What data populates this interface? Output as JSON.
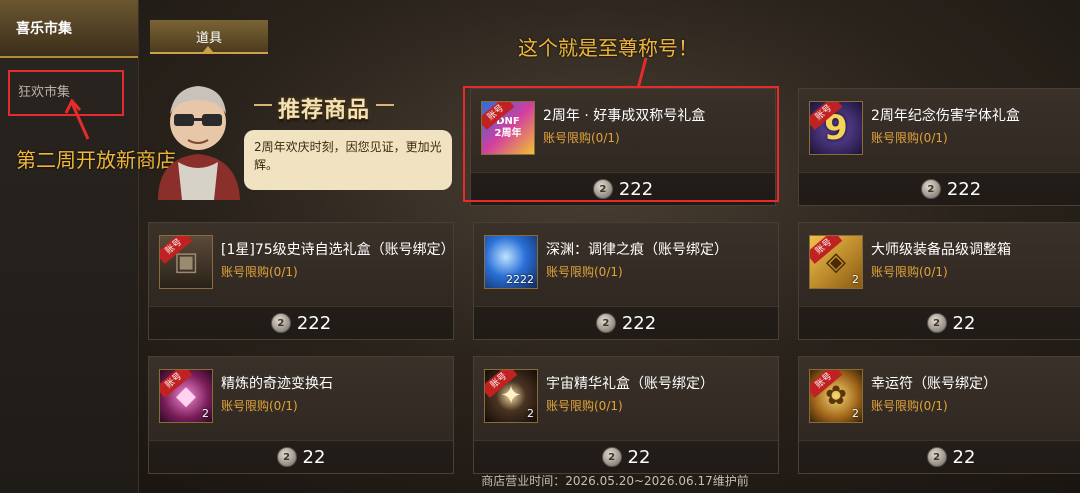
{
  "sidebar": {
    "market_tab": "喜乐市集",
    "sub_tab": "狂欢市集"
  },
  "tabs": {
    "items": "道具"
  },
  "annotations": {
    "left_note": "第二周开放新商店",
    "top_note": "这个就是至尊称号！"
  },
  "recommend": {
    "title": "推荐商品",
    "bubble": "2周年欢庆时刻，因您见证，更加光辉。"
  },
  "cards": [
    {
      "name": "2周年 · 好事成双称号礼盒",
      "limit": "账号限购(0/1)",
      "price": "222",
      "badge": "账号",
      "icon": "dnf-title-box-icon",
      "qty": ""
    },
    {
      "name": "2周年纪念伤害字体礼盒",
      "limit": "账号限购(0/1)",
      "price": "222",
      "badge": "账号",
      "icon": "number-nine-icon",
      "qty": ""
    },
    {
      "name": "[1星]75级史诗自选礼盒（账号绑定）",
      "limit": "账号限购(0/1)",
      "price": "222",
      "badge": "账号",
      "icon": "treasure-chest-icon",
      "qty": ""
    },
    {
      "name": "深渊：调律之痕（账号绑定）",
      "limit": "账号限购(0/1)",
      "price": "222",
      "badge": "",
      "icon": "blue-orb-icon",
      "qty": "2222"
    },
    {
      "name": "大师级装备品级调整箱",
      "limit": "账号限购(0/1)",
      "price": "22",
      "badge": "账号",
      "icon": "gold-cube-icon",
      "qty": "2"
    },
    {
      "name": "精炼的奇迹变换石",
      "limit": "账号限购(0/1)",
      "price": "22",
      "badge": "账号",
      "icon": "pink-crystal-icon",
      "qty": "2"
    },
    {
      "name": "宇宙精华礼盒（账号绑定）",
      "limit": "账号限购(0/1)",
      "price": "22",
      "badge": "账号",
      "icon": "dark-star-icon",
      "qty": "2"
    },
    {
      "name": "幸运符（账号绑定）",
      "limit": "账号限购(0/1)",
      "price": "22",
      "badge": "账号",
      "icon": "gold-charm-icon",
      "qty": "2"
    }
  ],
  "footer": "商店营业时间：2026.05.20~2026.06.17维护前",
  "colors": {
    "accent_gold": "#e2a43b",
    "annotation_red": "#e52b2b",
    "annotation_text": "#f0b73a"
  }
}
